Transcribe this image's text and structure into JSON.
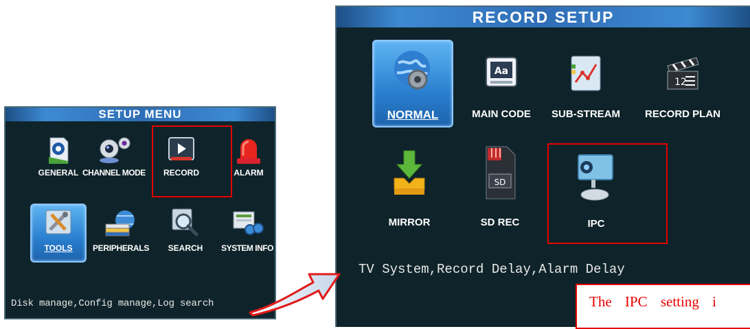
{
  "setup_menu": {
    "title": "SETUP  MENU",
    "items": [
      {
        "label": "GENERAL",
        "icon": "general-icon"
      },
      {
        "label": "CHANNEL MODE",
        "icon": "channel-mode-icon"
      },
      {
        "label": "RECORD",
        "icon": "record-icon"
      },
      {
        "label": "ALARM",
        "icon": "alarm-icon"
      },
      {
        "label": "TOOLS",
        "icon": "tools-icon",
        "selected": true
      },
      {
        "label": "PERIPHERALS",
        "icon": "peripherals-icon"
      },
      {
        "label": "SEARCH",
        "icon": "search-icon"
      },
      {
        "label": "SYSTEM INFO",
        "icon": "system-info-icon"
      }
    ],
    "description": "Disk manage,Config manage,Log search"
  },
  "record_setup": {
    "title": "RECORD  SETUP",
    "items": [
      {
        "label": "NORMAL",
        "icon": "globe-gear-icon",
        "selected": true
      },
      {
        "label": "MAIN CODE",
        "icon": "main-code-icon"
      },
      {
        "label": "SUB-STREAM",
        "icon": "sub-stream-icon"
      },
      {
        "label": "RECORD PLAN",
        "icon": "clapperboard-icon"
      },
      {
        "label": "MIRROR",
        "icon": "mirror-download-icon"
      },
      {
        "label": "SD REC",
        "icon": "sd-card-icon"
      },
      {
        "label": "IPC",
        "icon": "ip-camera-icon"
      }
    ],
    "description": "TV System,Record Delay,Alarm Delay"
  },
  "annotation": {
    "note_text": "The IPC setting i",
    "highlight_color": "#e60000"
  },
  "colors": {
    "panel_bg": "#0f242a",
    "title_bar": "#2f6eb6",
    "selection": "#2a7fcf"
  }
}
